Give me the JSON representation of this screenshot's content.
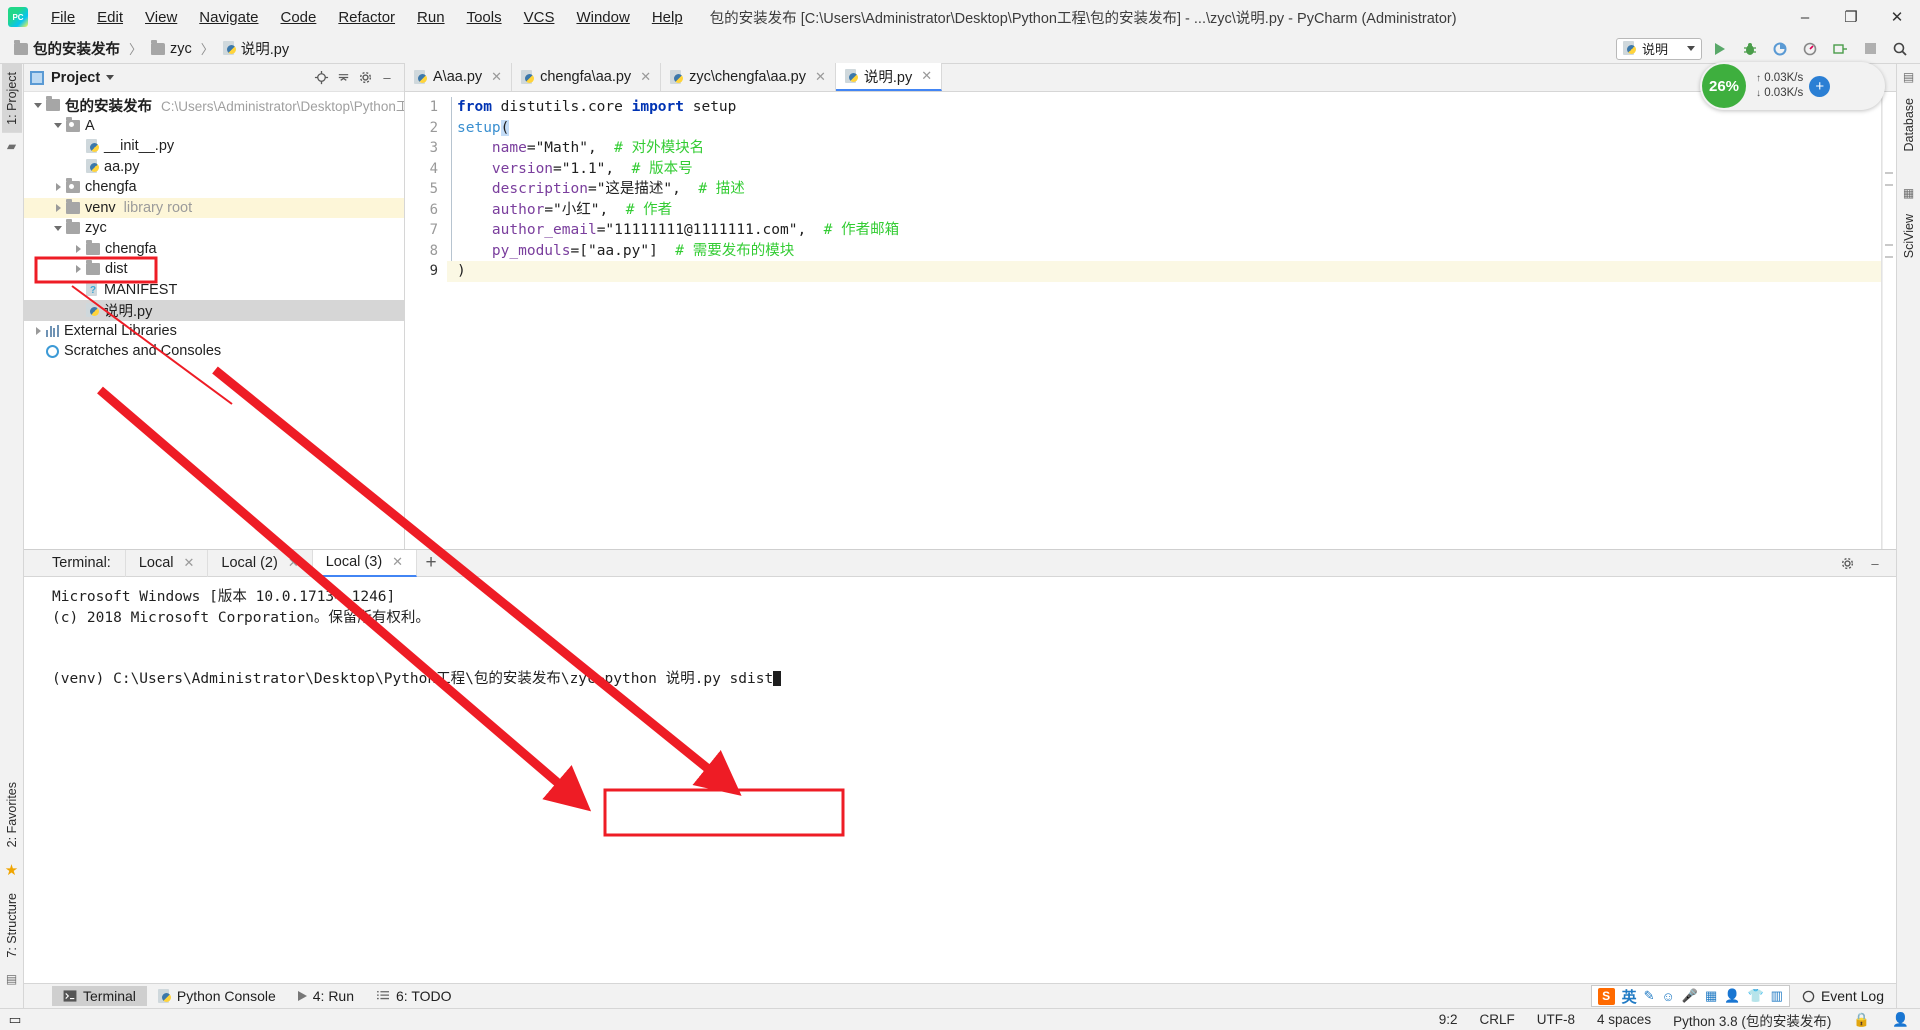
{
  "titlebar": {
    "menus": [
      "File",
      "Edit",
      "View",
      "Navigate",
      "Code",
      "Refactor",
      "Run",
      "Tools",
      "VCS",
      "Window",
      "Help"
    ],
    "window_title": "包的安装发布 [C:\\Users\\Administrator\\Desktop\\Python工程\\包的安装发布] - ...\\zyc\\说明.py - PyCharm (Administrator)",
    "minimize": "–",
    "maximize": "❐",
    "close": "✕"
  },
  "navbar": {
    "breadcrumbs": [
      "包的安装发布",
      "zyc",
      "说明.py"
    ],
    "separator": "〉",
    "run_config": "说明",
    "buttons": [
      "run",
      "debug",
      "coverage",
      "profile",
      "attach",
      "stop",
      "search"
    ]
  },
  "cpu_widget": {
    "percent": "26%",
    "up_rate": "0.03K/s",
    "down_rate": "0.03K/s",
    "plus": "+"
  },
  "left_rail": {
    "project_label": "1: Project",
    "favorites_label": "2: Favorites",
    "structure_label": "7: Structure"
  },
  "right_rail": {
    "database_label": "Database",
    "sciview_label": "SciView"
  },
  "project_panel": {
    "title": "Project",
    "tree": [
      {
        "indent": 0,
        "arrow": "down",
        "icon": "folder",
        "label": "包的安装发布",
        "bold": true,
        "path": "C:\\Users\\Administrator\\Desktop\\Python工程",
        "state": "normal"
      },
      {
        "indent": 1,
        "arrow": "down",
        "icon": "package",
        "label": "A",
        "bold": false,
        "path": "",
        "state": "normal"
      },
      {
        "indent": 2,
        "arrow": "none",
        "icon": "python",
        "label": "__init__.py",
        "bold": false,
        "path": "",
        "state": "normal"
      },
      {
        "indent": 2,
        "arrow": "none",
        "icon": "python",
        "label": "aa.py",
        "bold": false,
        "path": "",
        "state": "normal"
      },
      {
        "indent": 1,
        "arrow": "right",
        "icon": "package",
        "label": "chengfa",
        "bold": false,
        "path": "",
        "state": "normal"
      },
      {
        "indent": 1,
        "arrow": "right",
        "icon": "folder",
        "label": "venv",
        "bold": false,
        "suffix": "library root",
        "state": "highlight"
      },
      {
        "indent": 1,
        "arrow": "down",
        "icon": "folder",
        "label": "zyc",
        "bold": false,
        "path": "",
        "state": "boxed"
      },
      {
        "indent": 2,
        "arrow": "right",
        "icon": "folder",
        "label": "chengfa",
        "bold": false,
        "path": "",
        "state": "normal"
      },
      {
        "indent": 2,
        "arrow": "right",
        "icon": "folder",
        "label": "dist",
        "bold": false,
        "path": "",
        "state": "normal"
      },
      {
        "indent": 2,
        "arrow": "none",
        "icon": "manifest",
        "label": "MANIFEST",
        "bold": false,
        "path": "",
        "state": "normal"
      },
      {
        "indent": 2,
        "arrow": "none",
        "icon": "python",
        "label": "说明.py",
        "bold": false,
        "path": "",
        "state": "selected"
      },
      {
        "indent": 0,
        "arrow": "right",
        "icon": "library",
        "label": "External Libraries",
        "bold": false,
        "path": "",
        "state": "normal"
      },
      {
        "indent": 0,
        "arrow": "none",
        "icon": "scratch",
        "label": "Scratches and Consoles",
        "bold": false,
        "path": "",
        "state": "normal"
      }
    ]
  },
  "editor": {
    "tabs": [
      {
        "label": "A\\aa.py",
        "active": false
      },
      {
        "label": "chengfa\\aa.py",
        "active": false
      },
      {
        "label": "zyc\\chengfa\\aa.py",
        "active": false
      },
      {
        "label": "说明.py",
        "active": true
      }
    ],
    "close_glyph": "✕",
    "line_numbers": [
      "1",
      "2",
      "3",
      "4",
      "5",
      "6",
      "7",
      "8",
      "9"
    ],
    "code_lines": [
      "from distutils.core import setup",
      "setup(",
      "    name=\"Math\",  # 对外模块名",
      "    version=\"1.1\",  # 版本号",
      "    description=\"这是描述\",  # 描述",
      "    author=\"小红\",  # 作者",
      "    author_email=\"11111111@1111111.com\",  # 作者邮箱",
      "    py_moduls=[\"aa.py\"]  # 需要发布的模块",
      ")"
    ],
    "current_line": 9
  },
  "terminal": {
    "label": "Terminal:",
    "tabs": [
      {
        "label": "Local",
        "active": false
      },
      {
        "label": "Local (2)",
        "active": false
      },
      {
        "label": "Local (3)",
        "active": true
      }
    ],
    "close_glyph": "✕",
    "add_glyph": "+",
    "settings_glyph": "⚙",
    "minimize_glyph": "–",
    "lines": [
      "Microsoft Windows [版本 10.0.17134.1246]",
      "(c) 2018 Microsoft Corporation。保留所有权利。",
      "",
      "(venv) C:\\Users\\Administrator\\Desktop\\Python工程\\包的安装发布\\zyc>"
    ],
    "command": "python 说明.py sdist"
  },
  "bottom_bar": {
    "buttons": [
      {
        "label": "Terminal",
        "icon": "terminal-icon",
        "selected": true
      },
      {
        "label": "Python Console",
        "icon": "python-icon",
        "selected": false
      },
      {
        "label": "4: Run",
        "icon": "run-icon",
        "selected": false
      },
      {
        "label": "6: TODO",
        "icon": "list-icon",
        "selected": false
      }
    ],
    "ime": {
      "logo": "S",
      "lang": "英",
      "items": [
        "✎",
        ":)",
        "🎤",
        "⌨",
        "👤",
        "👕",
        "▦"
      ]
    },
    "event_log": "Event Log"
  },
  "status_bar": {
    "caret": "9:2",
    "line_sep": "CRLF",
    "encoding": "UTF-8",
    "indent": "4 spaces",
    "interpreter": "Python 3.8 (包的安装发布)",
    "lock_icon": "🔒",
    "hector_icon": "👤"
  },
  "annotations": {
    "box_color": "#ee1c25",
    "arrow1": {
      "label": "arrow-from-zyc-to-command"
    },
    "arrow2": {
      "label": "arrow-from-shuoming-to-command"
    }
  }
}
